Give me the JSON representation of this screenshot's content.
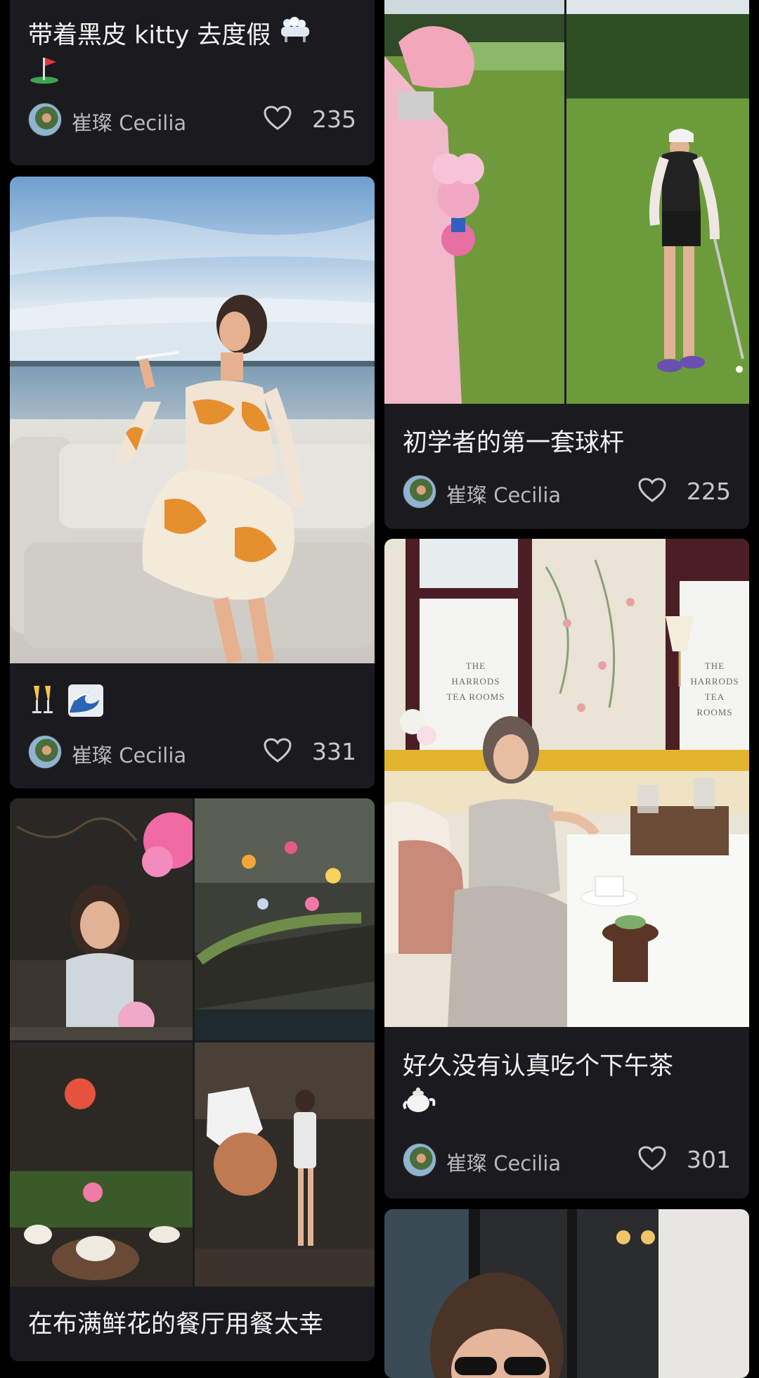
{
  "cards": {
    "c1": {
      "title_line1": "带着黑皮 kitty 去度假",
      "author": "崔璨 Cecilia",
      "likes": "235"
    },
    "c2": {
      "author": "崔璨 Cecilia",
      "likes": "331"
    },
    "c3": {
      "title_line1": "在布满鲜花的餐厅用餐太幸"
    },
    "c4": {
      "title_line1": "初学者的第一套球杆",
      "author": "崔璨 Cecilia",
      "likes": "225"
    },
    "c5": {
      "title_line1": "好久没有认真吃个下午茶",
      "author": "崔璨 Cecilia",
      "likes": "301"
    }
  },
  "photo_text": {
    "tea_rooms_sign": "THE HARRODS TEA ROOMS",
    "tea_rooms_sign_right": "THE HARRODS TEA ROOMS"
  },
  "icons": {
    "bathtub": "bathtub-emoji",
    "golf_flag": "golf-flag-emoji",
    "champagne": "champagne-emoji",
    "wave": "wave-emoji",
    "teapot": "teapot-emoji",
    "heart": "heart-outline-icon"
  },
  "colors": {
    "background": "#000000",
    "card": "#1b1b1f",
    "text": "#f2f2f2",
    "muted": "#b9b9bd"
  }
}
